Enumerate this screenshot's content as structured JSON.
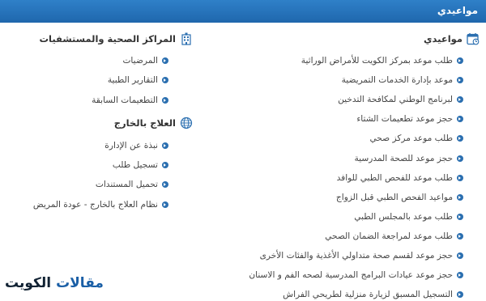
{
  "header": {
    "title": "مواعيدي"
  },
  "appointments": {
    "title": "مواعيدي",
    "icon": "calendar-icon",
    "items": [
      "طلب موعد بمركز الكويت للأمراض الوراثية",
      "موعد بإدارة الخدمات التمريضية",
      "لبرنامج الوطني لمكافحة التدخين",
      "حجز موعد تطعيمات الشتاء",
      "طلب موعد مركز صحي",
      "حجز موعد للصحة المدرسية",
      "طلب موعد للفحص الطبي للوافد",
      "مواعيد الفحص الطبي قبل الزواج",
      "طلب موعد بالمجلس الطبي",
      "طلب موعد لمراجعة الضمان الصحي",
      "حجز موعد لقسم صحة متداولي الأغذية والفئات الأخرى",
      "حجز موعد عيادات البرامج المدرسية لصحه الفم و الاسنان",
      "التسجيل المسبق لزيارة منزلية لطريحي الفراش"
    ]
  },
  "health_centers": {
    "title": "المراكز الصحية والمستشفيات",
    "icon": "hospital-building-icon",
    "items": [
      "المرضيات",
      "التقارير الطبية",
      "التطعيمات السابقة"
    ]
  },
  "treatment_abroad": {
    "title": "العلاج بالخارج",
    "icon": "globe-icon",
    "items": [
      "نبذة عن الإدارة",
      "تسجيل طلب",
      "تحميل المستندات",
      "نظام العلاج بالخارج - عودة المريض"
    ]
  },
  "watermark": {
    "part1": "مقالات",
    "part2": " الكويت"
  },
  "colors": {
    "header": "#2474bb",
    "bullet": "#2b6fb0",
    "text": "#444444"
  }
}
